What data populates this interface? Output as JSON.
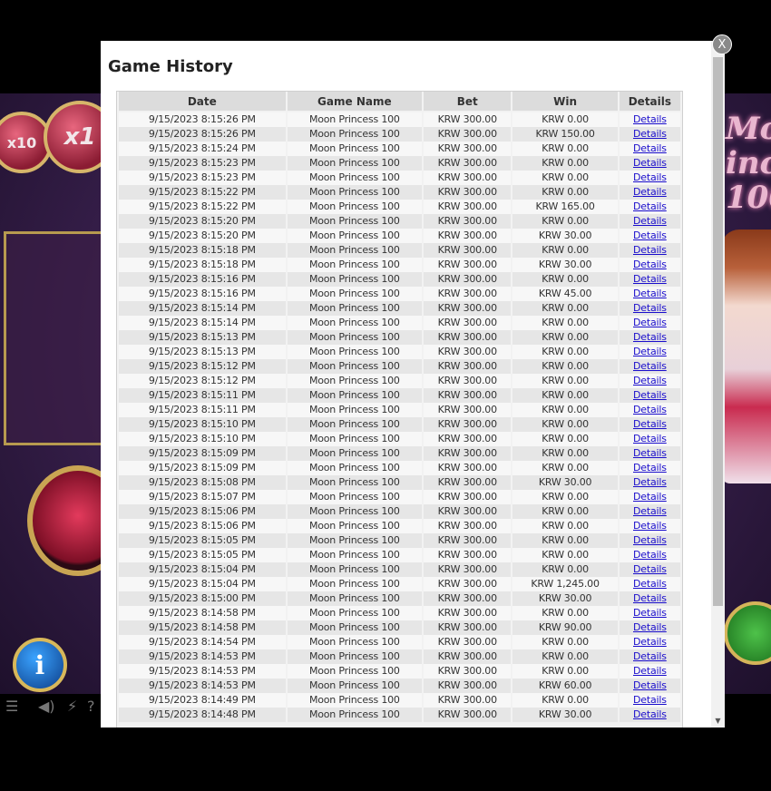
{
  "modal": {
    "title": "Game History",
    "close_label": "X"
  },
  "table": {
    "headers": [
      "Date",
      "Game Name",
      "Bet",
      "Win",
      "Details"
    ],
    "details_label": "Details",
    "rows": [
      {
        "date": "9/15/2023 8:15:26 PM",
        "game": "Moon Princess 100",
        "bet": "KRW 300.00",
        "win": "KRW 0.00"
      },
      {
        "date": "9/15/2023 8:15:26 PM",
        "game": "Moon Princess 100",
        "bet": "KRW 300.00",
        "win": "KRW 150.00"
      },
      {
        "date": "9/15/2023 8:15:24 PM",
        "game": "Moon Princess 100",
        "bet": "KRW 300.00",
        "win": "KRW 0.00"
      },
      {
        "date": "9/15/2023 8:15:23 PM",
        "game": "Moon Princess 100",
        "bet": "KRW 300.00",
        "win": "KRW 0.00"
      },
      {
        "date": "9/15/2023 8:15:23 PM",
        "game": "Moon Princess 100",
        "bet": "KRW 300.00",
        "win": "KRW 0.00"
      },
      {
        "date": "9/15/2023 8:15:22 PM",
        "game": "Moon Princess 100",
        "bet": "KRW 300.00",
        "win": "KRW 0.00"
      },
      {
        "date": "9/15/2023 8:15:22 PM",
        "game": "Moon Princess 100",
        "bet": "KRW 300.00",
        "win": "KRW 165.00"
      },
      {
        "date": "9/15/2023 8:15:20 PM",
        "game": "Moon Princess 100",
        "bet": "KRW 300.00",
        "win": "KRW 0.00"
      },
      {
        "date": "9/15/2023 8:15:20 PM",
        "game": "Moon Princess 100",
        "bet": "KRW 300.00",
        "win": "KRW 30.00"
      },
      {
        "date": "9/15/2023 8:15:18 PM",
        "game": "Moon Princess 100",
        "bet": "KRW 300.00",
        "win": "KRW 0.00"
      },
      {
        "date": "9/15/2023 8:15:18 PM",
        "game": "Moon Princess 100",
        "bet": "KRW 300.00",
        "win": "KRW 30.00"
      },
      {
        "date": "9/15/2023 8:15:16 PM",
        "game": "Moon Princess 100",
        "bet": "KRW 300.00",
        "win": "KRW 0.00"
      },
      {
        "date": "9/15/2023 8:15:16 PM",
        "game": "Moon Princess 100",
        "bet": "KRW 300.00",
        "win": "KRW 45.00"
      },
      {
        "date": "9/15/2023 8:15:14 PM",
        "game": "Moon Princess 100",
        "bet": "KRW 300.00",
        "win": "KRW 0.00"
      },
      {
        "date": "9/15/2023 8:15:14 PM",
        "game": "Moon Princess 100",
        "bet": "KRW 300.00",
        "win": "KRW 0.00"
      },
      {
        "date": "9/15/2023 8:15:13 PM",
        "game": "Moon Princess 100",
        "bet": "KRW 300.00",
        "win": "KRW 0.00"
      },
      {
        "date": "9/15/2023 8:15:13 PM",
        "game": "Moon Princess 100",
        "bet": "KRW 300.00",
        "win": "KRW 0.00"
      },
      {
        "date": "9/15/2023 8:15:12 PM",
        "game": "Moon Princess 100",
        "bet": "KRW 300.00",
        "win": "KRW 0.00"
      },
      {
        "date": "9/15/2023 8:15:12 PM",
        "game": "Moon Princess 100",
        "bet": "KRW 300.00",
        "win": "KRW 0.00"
      },
      {
        "date": "9/15/2023 8:15:11 PM",
        "game": "Moon Princess 100",
        "bet": "KRW 300.00",
        "win": "KRW 0.00"
      },
      {
        "date": "9/15/2023 8:15:11 PM",
        "game": "Moon Princess 100",
        "bet": "KRW 300.00",
        "win": "KRW 0.00"
      },
      {
        "date": "9/15/2023 8:15:10 PM",
        "game": "Moon Princess 100",
        "bet": "KRW 300.00",
        "win": "KRW 0.00"
      },
      {
        "date": "9/15/2023 8:15:10 PM",
        "game": "Moon Princess 100",
        "bet": "KRW 300.00",
        "win": "KRW 0.00"
      },
      {
        "date": "9/15/2023 8:15:09 PM",
        "game": "Moon Princess 100",
        "bet": "KRW 300.00",
        "win": "KRW 0.00"
      },
      {
        "date": "9/15/2023 8:15:09 PM",
        "game": "Moon Princess 100",
        "bet": "KRW 300.00",
        "win": "KRW 0.00"
      },
      {
        "date": "9/15/2023 8:15:08 PM",
        "game": "Moon Princess 100",
        "bet": "KRW 300.00",
        "win": "KRW 30.00"
      },
      {
        "date": "9/15/2023 8:15:07 PM",
        "game": "Moon Princess 100",
        "bet": "KRW 300.00",
        "win": "KRW 0.00"
      },
      {
        "date": "9/15/2023 8:15:06 PM",
        "game": "Moon Princess 100",
        "bet": "KRW 300.00",
        "win": "KRW 0.00"
      },
      {
        "date": "9/15/2023 8:15:06 PM",
        "game": "Moon Princess 100",
        "bet": "KRW 300.00",
        "win": "KRW 0.00"
      },
      {
        "date": "9/15/2023 8:15:05 PM",
        "game": "Moon Princess 100",
        "bet": "KRW 300.00",
        "win": "KRW 0.00"
      },
      {
        "date": "9/15/2023 8:15:05 PM",
        "game": "Moon Princess 100",
        "bet": "KRW 300.00",
        "win": "KRW 0.00"
      },
      {
        "date": "9/15/2023 8:15:04 PM",
        "game": "Moon Princess 100",
        "bet": "KRW 300.00",
        "win": "KRW 0.00"
      },
      {
        "date": "9/15/2023 8:15:04 PM",
        "game": "Moon Princess 100",
        "bet": "KRW 300.00",
        "win": "KRW 1,245.00"
      },
      {
        "date": "9/15/2023 8:15:00 PM",
        "game": "Moon Princess 100",
        "bet": "KRW 300.00",
        "win": "KRW 30.00"
      },
      {
        "date": "9/15/2023 8:14:58 PM",
        "game": "Moon Princess 100",
        "bet": "KRW 300.00",
        "win": "KRW 0.00"
      },
      {
        "date": "9/15/2023 8:14:58 PM",
        "game": "Moon Princess 100",
        "bet": "KRW 300.00",
        "win": "KRW 90.00"
      },
      {
        "date": "9/15/2023 8:14:54 PM",
        "game": "Moon Princess 100",
        "bet": "KRW 300.00",
        "win": "KRW 0.00"
      },
      {
        "date": "9/15/2023 8:14:53 PM",
        "game": "Moon Princess 100",
        "bet": "KRW 300.00",
        "win": "KRW 0.00"
      },
      {
        "date": "9/15/2023 8:14:53 PM",
        "game": "Moon Princess 100",
        "bet": "KRW 300.00",
        "win": "KRW 0.00"
      },
      {
        "date": "9/15/2023 8:14:53 PM",
        "game": "Moon Princess 100",
        "bet": "KRW 300.00",
        "win": "KRW 60.00"
      },
      {
        "date": "9/15/2023 8:14:49 PM",
        "game": "Moon Princess 100",
        "bet": "KRW 300.00",
        "win": "KRW 0.00"
      },
      {
        "date": "9/15/2023 8:14:48 PM",
        "game": "Moon Princess 100",
        "bet": "KRW 300.00",
        "win": "KRW 30.00"
      }
    ]
  },
  "background_game": {
    "multiplier_small": "x10",
    "multiplier_large": "x1",
    "logo_text": "Mo\nince\n100",
    "info_label": "i",
    "bottom_icons": [
      "menu-icon",
      "sound-icon",
      "turbo-icon",
      "help-icon"
    ],
    "bottom_glyphs": {
      "menu": "☰",
      "sound": "◀)",
      "turbo": "⚡",
      "help": "?"
    }
  }
}
